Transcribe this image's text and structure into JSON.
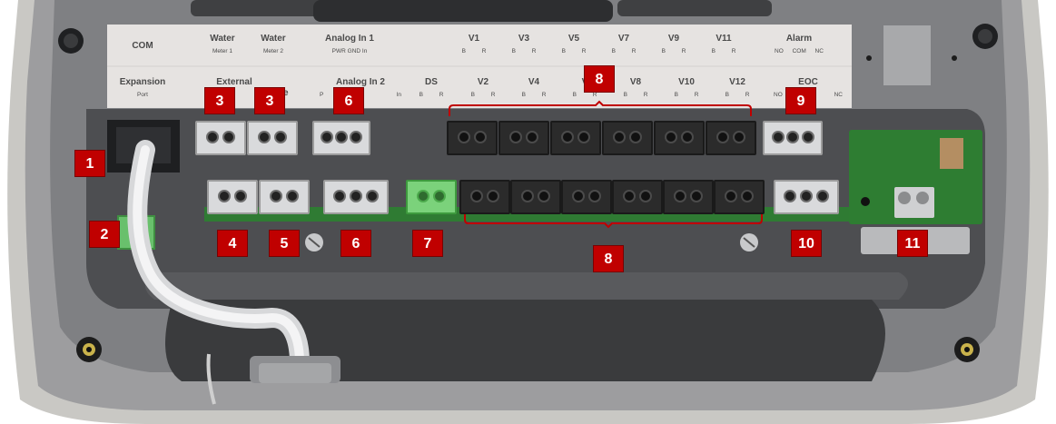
{
  "labels": {
    "com": "COM",
    "expansion": {
      "title": "Expansion",
      "sub": "Port"
    },
    "water1": {
      "title": "Water",
      "sub": "Meter 1"
    },
    "water2": {
      "title": "Water",
      "sub": "Meter 2"
    },
    "external": "External",
    "external_suffix": "se",
    "analog_in_1": {
      "title": "Analog In 1",
      "sub": "PWR  GND  In"
    },
    "analog_in_2": {
      "title": "Analog In 2",
      "sub_left": "P",
      "sub_right": "In"
    },
    "ds": {
      "title": "DS",
      "sub": "B   R"
    },
    "top_valves": [
      "V1",
      "V3",
      "V5",
      "V7",
      "V9",
      "V11"
    ],
    "bottom_valves": [
      "V2",
      "V4",
      "V",
      "V8",
      "V10",
      "V12"
    ],
    "valve_sub": "B   R",
    "alarm": {
      "title": "Alarm",
      "sub": "NO  COM  NC"
    },
    "eoc": {
      "title": "EOC",
      "sub_left": "NO",
      "sub_right": "NC"
    }
  },
  "markers": [
    "1",
    "2",
    "3",
    "3",
    "4",
    "5",
    "6",
    "6",
    "7",
    "8",
    "8",
    "9",
    "10",
    "11"
  ],
  "colors": {
    "marker_red": "#c00000",
    "label_panel": "#e6e3e1",
    "enclosure_grey": "#9b9c9e",
    "pcb_green": "#2e7d32"
  }
}
